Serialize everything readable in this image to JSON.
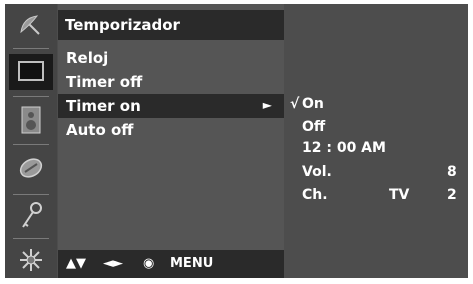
{
  "menu": {
    "title": "Temporizador",
    "items": [
      {
        "label": "Reloj"
      },
      {
        "label": "Timer off"
      },
      {
        "label": "Timer on",
        "arrow": "►"
      },
      {
        "label": "Auto off"
      }
    ]
  },
  "navbar": {
    "updown": "▲▼",
    "leftright": "◄►",
    "ok": "◉",
    "menu_label": "MENU"
  },
  "submenu": {
    "check": "√",
    "on": "On",
    "off": "Off",
    "time": "12 : 00 AM",
    "vol_label": "Vol.",
    "vol_value": "8",
    "ch_label": "Ch.",
    "ch_source": "TV",
    "ch_value": "2"
  },
  "icons": [
    "satellite-dish-icon",
    "picture-icon",
    "speaker-icon",
    "clock-icon",
    "key-icon",
    "connector-icon"
  ],
  "colors": {
    "panel": "#4d4d4d",
    "menu": "#555555",
    "highlight": "#2a2a2a",
    "text": "#ffffff"
  }
}
